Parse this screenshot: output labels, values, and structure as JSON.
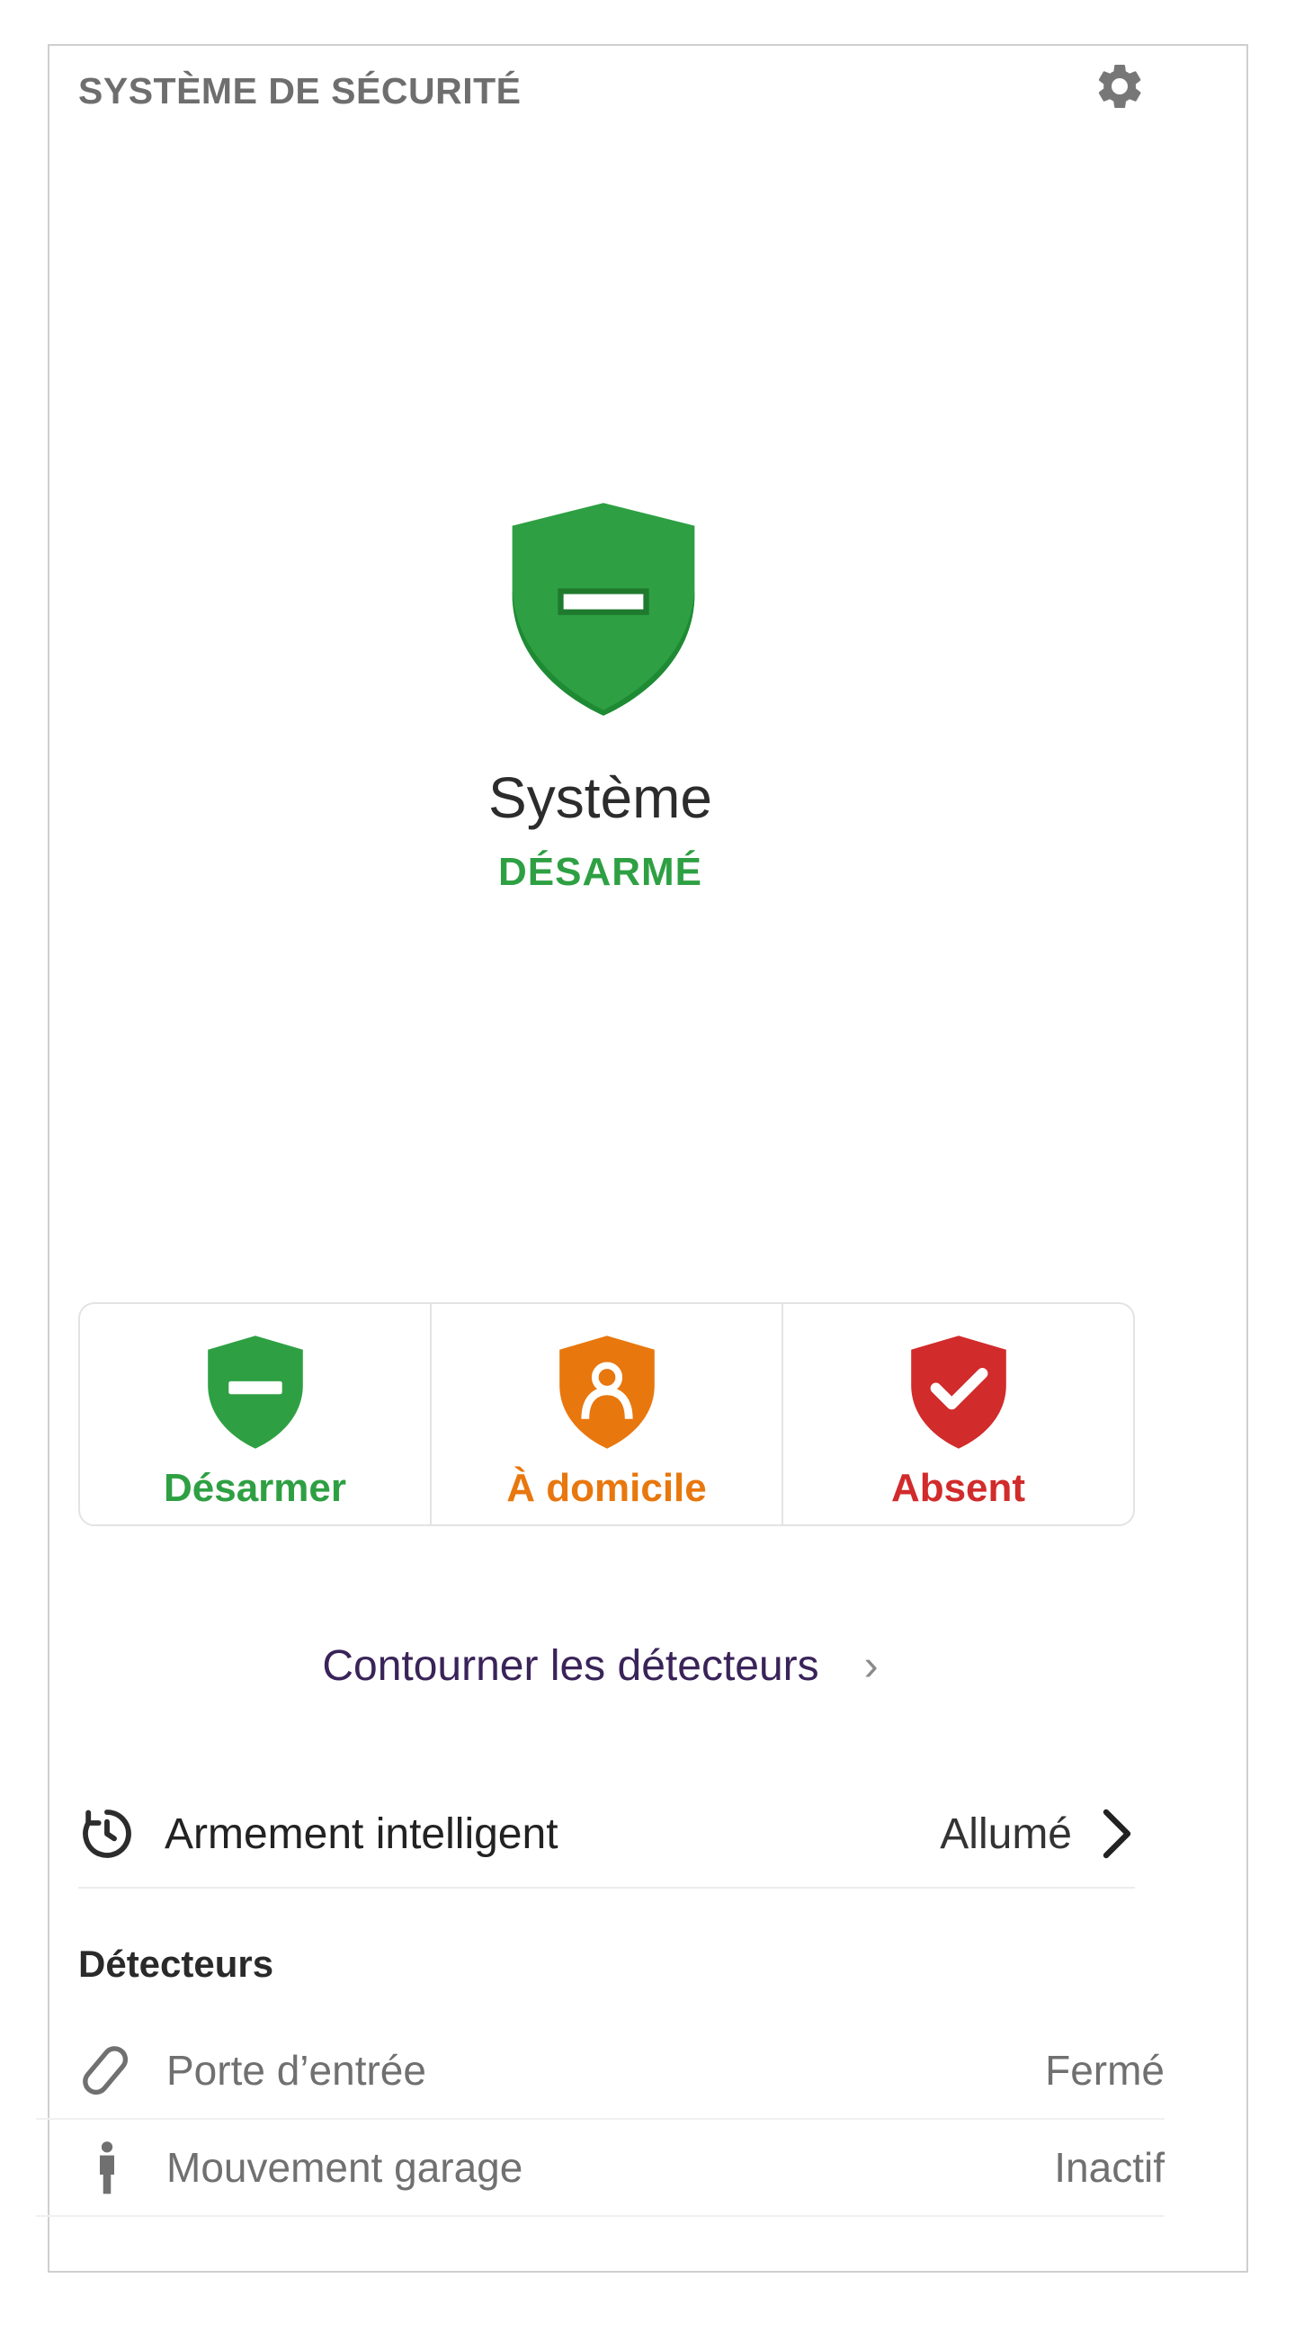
{
  "header": {
    "title": "SYSTÈME DE SÉCURITÉ",
    "settings_icon": "gear-icon"
  },
  "status": {
    "title": "Système",
    "state": "DÉSARMÉ",
    "state_color": "#2ea043",
    "shield_icon": "shield-minus-icon"
  },
  "modes": [
    {
      "label": "Désarmer",
      "color": "#2ea043",
      "icon": "shield-minus-icon"
    },
    {
      "label": "À domicile",
      "color": "#e8770e",
      "icon": "shield-person-icon"
    },
    {
      "label": "Absent",
      "color": "#d12b2b",
      "icon": "shield-check-icon"
    }
  ],
  "bypass": {
    "label": "Contourner les détecteurs"
  },
  "smart_arming": {
    "label": "Armement intelligent",
    "value": "Allumé",
    "icon": "timer-icon"
  },
  "sensors": {
    "title": "Détecteurs",
    "items": [
      {
        "name": "Porte d’entrée",
        "state": "Fermé",
        "icon": "door-sensor-icon"
      },
      {
        "name": "Mouvement garage",
        "state": "Inactif",
        "icon": "motion-person-icon"
      }
    ]
  }
}
